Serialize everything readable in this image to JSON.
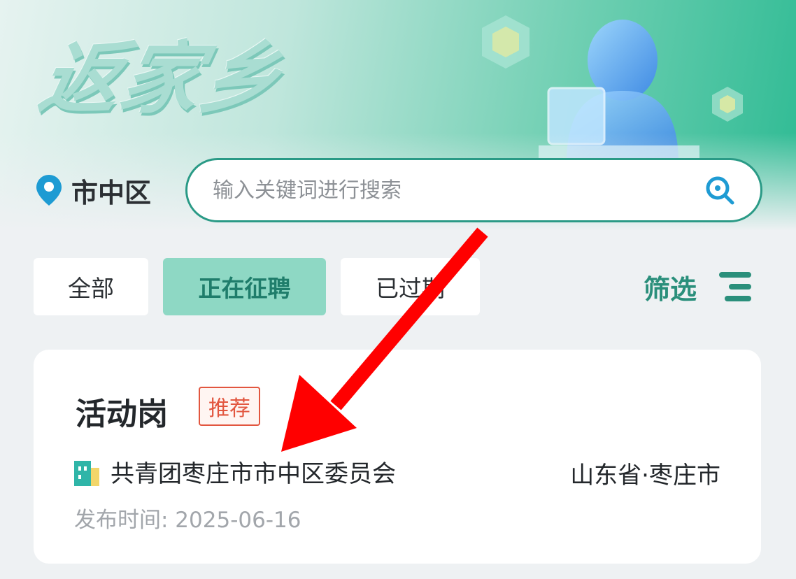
{
  "banner": {
    "logo_text": "返家乡"
  },
  "location": {
    "label": "市中区",
    "icon": "location-pin-icon"
  },
  "search": {
    "placeholder": "输入关键词进行搜索",
    "icon": "search-icon"
  },
  "tabs": [
    {
      "label": "全部",
      "active": false
    },
    {
      "label": "正在征聘",
      "active": true
    },
    {
      "label": "已过期",
      "active": false
    }
  ],
  "filter": {
    "label": "筛选",
    "icon": "filter-lines-icon"
  },
  "job_card": {
    "title": "活动岗",
    "badge": "推荐",
    "organization": "共青团枣庄市市中区委员会",
    "organization_icon": "building-icon",
    "region": "山东省·枣庄市",
    "publish_date": "发布时间: 2025-06-16"
  },
  "colors": {
    "accent": "#2a9a86",
    "active_tab_bg": "#8ed8c4",
    "badge_red": "#e2563f",
    "annotation_arrow": "#ff0000"
  }
}
